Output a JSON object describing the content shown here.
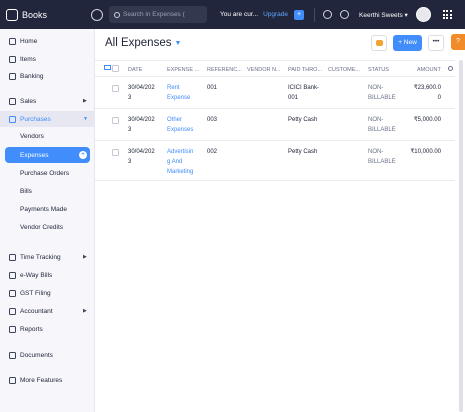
{
  "topbar": {
    "app_name": "Books",
    "search_placeholder": "Search in Expenses (",
    "trial_text": "You are cur...",
    "upgrade_label": "Upgrade",
    "org_name": "Keerthi Sweets ▾"
  },
  "sidebar": {
    "items": [
      {
        "label": "Home",
        "icon": "home-icon"
      },
      {
        "label": "Items",
        "icon": "items-icon"
      },
      {
        "label": "Banking",
        "icon": "banking-icon"
      },
      {
        "label": "Sales",
        "icon": "cart-icon"
      },
      {
        "label": "Purchases",
        "icon": "bag-icon"
      },
      {
        "label": "Vendors"
      },
      {
        "label": "Expenses"
      },
      {
        "label": "Purchase Orders"
      },
      {
        "label": "Bills"
      },
      {
        "label": "Payments Made"
      },
      {
        "label": "Vendor Credits"
      },
      {
        "label": "Time Tracking",
        "icon": "clock-icon"
      },
      {
        "label": "e-Way Bills",
        "icon": "truck-icon"
      },
      {
        "label": "GST Filing",
        "icon": "document-icon"
      },
      {
        "label": "Accountant",
        "icon": "accountant-icon"
      },
      {
        "label": "Reports",
        "icon": "chart-icon"
      },
      {
        "label": "Documents",
        "icon": "folder-icon"
      },
      {
        "label": "More Features",
        "icon": "star-icon"
      }
    ]
  },
  "main": {
    "title": "All Expenses",
    "new_label": "+ New",
    "more_label": "•••",
    "help_label": "?",
    "columns": [
      "DATE",
      "EXPENSE ...",
      "REFERENC...",
      "VENDOR N...",
      "PAID THRO...",
      "CUSTOME...",
      "STATUS",
      "AMOUNT"
    ],
    "rows": [
      {
        "date": [
          "30/04/202",
          "3"
        ],
        "account": [
          "Rent",
          "Expense"
        ],
        "reference": "001",
        "vendor": "",
        "paid_through": [
          "ICICI Bank-",
          "001"
        ],
        "customer": "",
        "status": [
          "NON-",
          "BILLABLE"
        ],
        "amount": [
          "₹23,600.0",
          "0"
        ]
      },
      {
        "date": [
          "30/04/202",
          "3"
        ],
        "account": [
          "Other",
          "Expenses"
        ],
        "reference": "003",
        "vendor": "",
        "paid_through": [
          "Petty Cash",
          ""
        ],
        "customer": "",
        "status": [
          "NON-",
          "BILLABLE"
        ],
        "amount": [
          "₹5,000.00",
          ""
        ]
      },
      {
        "date": [
          "30/04/202",
          "3"
        ],
        "account": [
          "Advertisin",
          "g And",
          "Marketing"
        ],
        "reference": "002",
        "vendor": "",
        "paid_through": [
          "Petty Cash",
          ""
        ],
        "customer": "",
        "status": [
          "NON-",
          "BILLABLE"
        ],
        "amount": [
          "₹10,000.00",
          ""
        ]
      }
    ]
  }
}
